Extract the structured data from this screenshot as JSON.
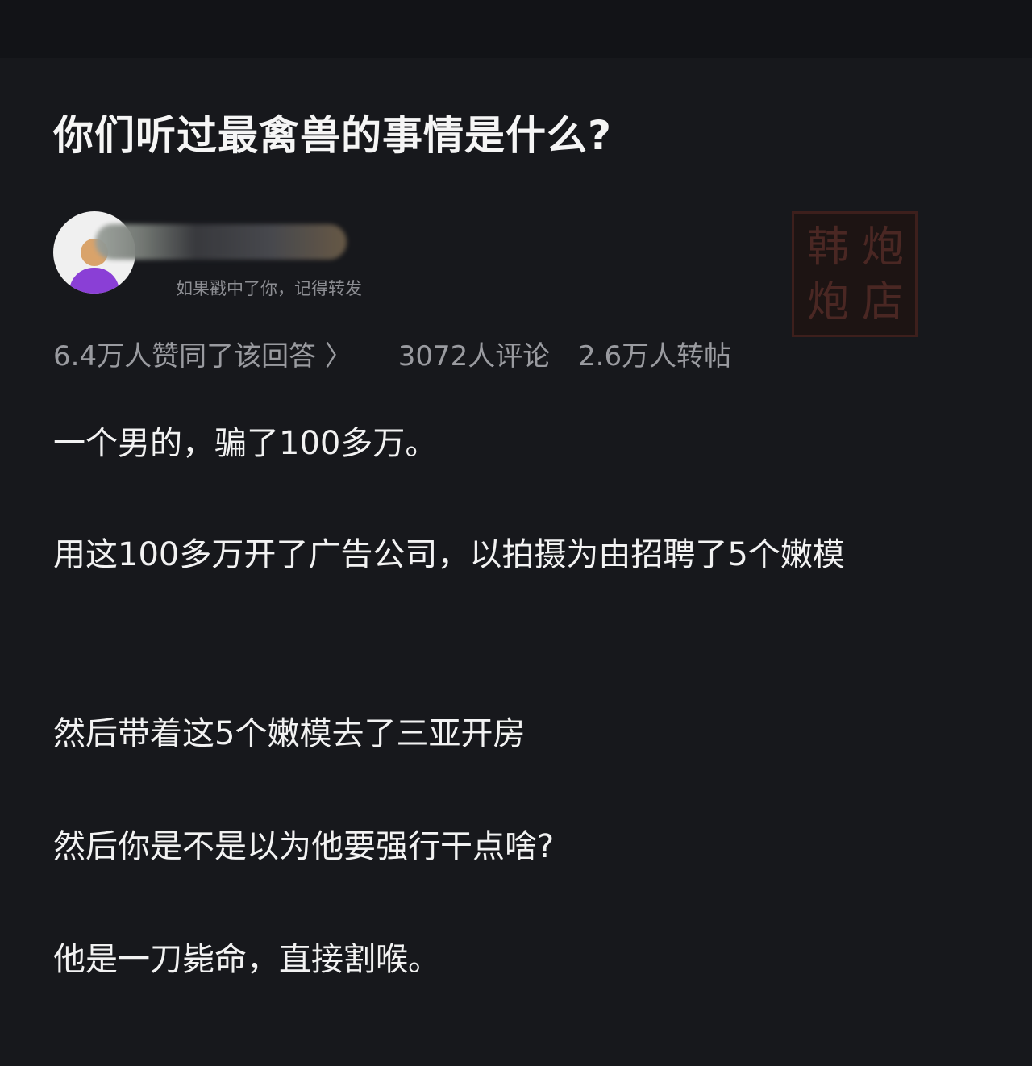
{
  "question": {
    "title": "你们听过最禽兽的事情是什么?"
  },
  "author": {
    "tagline": "如果戳中了你，记得转发",
    "avatar_icon": "avatar-icon"
  },
  "stamp": {
    "characters": [
      "韩",
      "炮",
      "炮",
      "店"
    ]
  },
  "stats": {
    "likes": "6.4万人赞同了该回答 〉",
    "comments": "3072人评论",
    "reposts": "2.6万人转帖"
  },
  "answer": {
    "paragraphs": [
      "一个男的，骗了100多万。",
      "用这100多万开了广告公司，以拍摄为由招聘了5个嫩模",
      "然后带着这5个嫩模去了三亚开房",
      "然后你是不是以为他要强行干点啥?",
      "他是一刀毙命，直接割喉。"
    ]
  }
}
